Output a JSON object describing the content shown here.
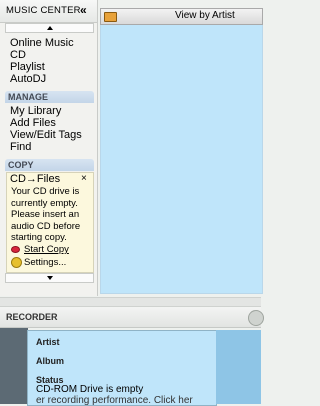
{
  "music_center": {
    "title": "MUSIC CENTER",
    "collapse_glyph": "«",
    "items": [
      "Online Music",
      "CD",
      "Playlist",
      "AutoDJ"
    ]
  },
  "manage": {
    "title": "MANAGE",
    "items": [
      "My Library",
      "Add Files",
      "View/Edit Tags",
      "Find"
    ]
  },
  "copy": {
    "title": "COPY",
    "panel_title": "CD→Files",
    "close_glyph": "×",
    "message": "Your CD drive is currently empty. Please insert an audio CD before starting copy.",
    "start_label": "Start Copy",
    "settings_label": "Settings..."
  },
  "view": {
    "title": "View by Artist"
  },
  "recorder": {
    "title": "RECORDER",
    "artist_label": "Artist",
    "album_label": "Album",
    "status_label": "Status",
    "status_value": "CD-ROM Drive is empty",
    "status_value_2": "er recording performance.  Click her"
  },
  "colors": {
    "view_background": "#bfe5fa",
    "section_header": "#c3d5e8",
    "copy_panel": "#fcf8dd"
  },
  "icons": [
    "collapse-icon",
    "folder-icon",
    "record-dot-icon",
    "settings-gear-icon"
  ]
}
